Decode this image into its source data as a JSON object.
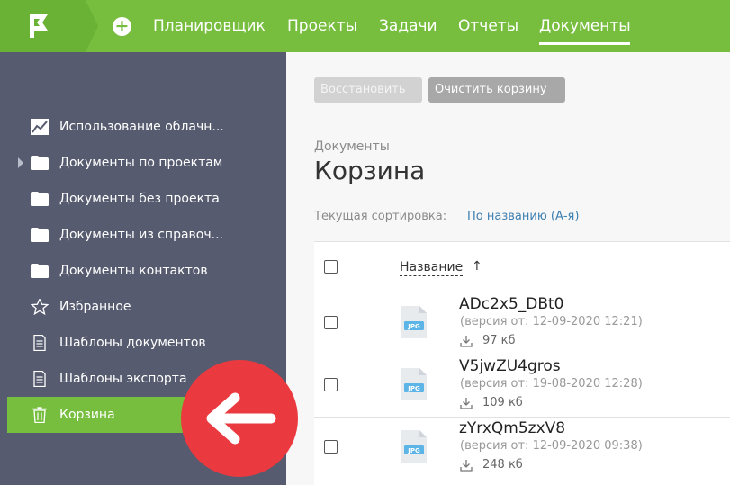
{
  "topnav": {
    "items": [
      {
        "label": "Планировщик"
      },
      {
        "label": "Проекты"
      },
      {
        "label": "Задачи"
      },
      {
        "label": "Отчеты"
      },
      {
        "label": "Документы"
      }
    ],
    "active": "Документы",
    "add_icon": "plus-circle-icon",
    "logo_icon": "flag-logo-icon"
  },
  "sidebar": {
    "items": [
      {
        "label": "Использование облачн...",
        "icon": "chart-icon"
      },
      {
        "label": "Документы по проектам",
        "icon": "folder-icon",
        "expandable": true
      },
      {
        "label": "Документы без проекта",
        "icon": "folder-icon"
      },
      {
        "label": "Документы из справоч...",
        "icon": "folder-icon"
      },
      {
        "label": "Документы контактов",
        "icon": "folder-icon"
      },
      {
        "label": "Избранное",
        "icon": "star-icon"
      },
      {
        "label": "Шаблоны документов",
        "icon": "document-icon"
      },
      {
        "label": "Шаблоны экспорта",
        "icon": "document-icon"
      },
      {
        "label": "Корзина",
        "icon": "trash-icon",
        "active": true
      }
    ]
  },
  "toolbar": {
    "restore_label": "Восстановить",
    "clear_label": "Очистить корзину"
  },
  "page": {
    "breadcrumb": "Документы",
    "title": "Корзина",
    "sort_label": "Текущая сортировка:",
    "sort_value": "По названию (А-я)"
  },
  "table": {
    "column_name": "Название",
    "sort_arrow": "↑",
    "rows": [
      {
        "name": "ADc2x5_DBt0",
        "version": "(версия от: 12-09-2020 12:21)",
        "size": "97 кб",
        "type": "JPG"
      },
      {
        "name": "V5jwZU4gros",
        "version": "(версия от: 19-08-2020 12:28)",
        "size": "109 кб",
        "type": "JPG"
      },
      {
        "name": "zYrxQm5zxV8",
        "version": "(версия от: 12-09-2020 09:38)",
        "size": "248 кб",
        "type": "JPG"
      }
    ]
  },
  "colors": {
    "brand_green": "#77be3f",
    "sidebar_bg": "#565b6f",
    "annotation_red": "#ea3a3f"
  },
  "annotation": {
    "icon": "arrow-left-icon"
  }
}
